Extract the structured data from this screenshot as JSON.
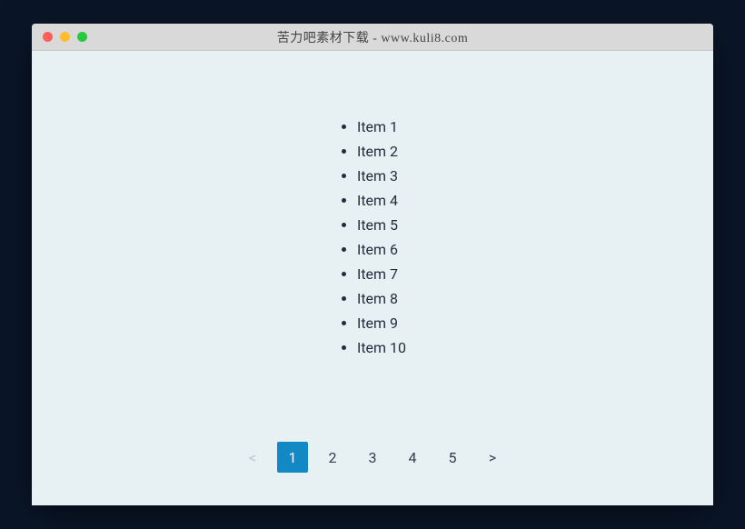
{
  "window": {
    "title": "苦力吧素材下载 - www.kuli8.com"
  },
  "list": {
    "items": [
      "Item 1",
      "Item 2",
      "Item 3",
      "Item 4",
      "Item 5",
      "Item 6",
      "Item 7",
      "Item 8",
      "Item 9",
      "Item 10"
    ]
  },
  "pagination": {
    "prev": "<",
    "next": ">",
    "pages": [
      "1",
      "2",
      "3",
      "4",
      "5"
    ],
    "active_index": 0,
    "prev_disabled": true,
    "next_disabled": false
  }
}
